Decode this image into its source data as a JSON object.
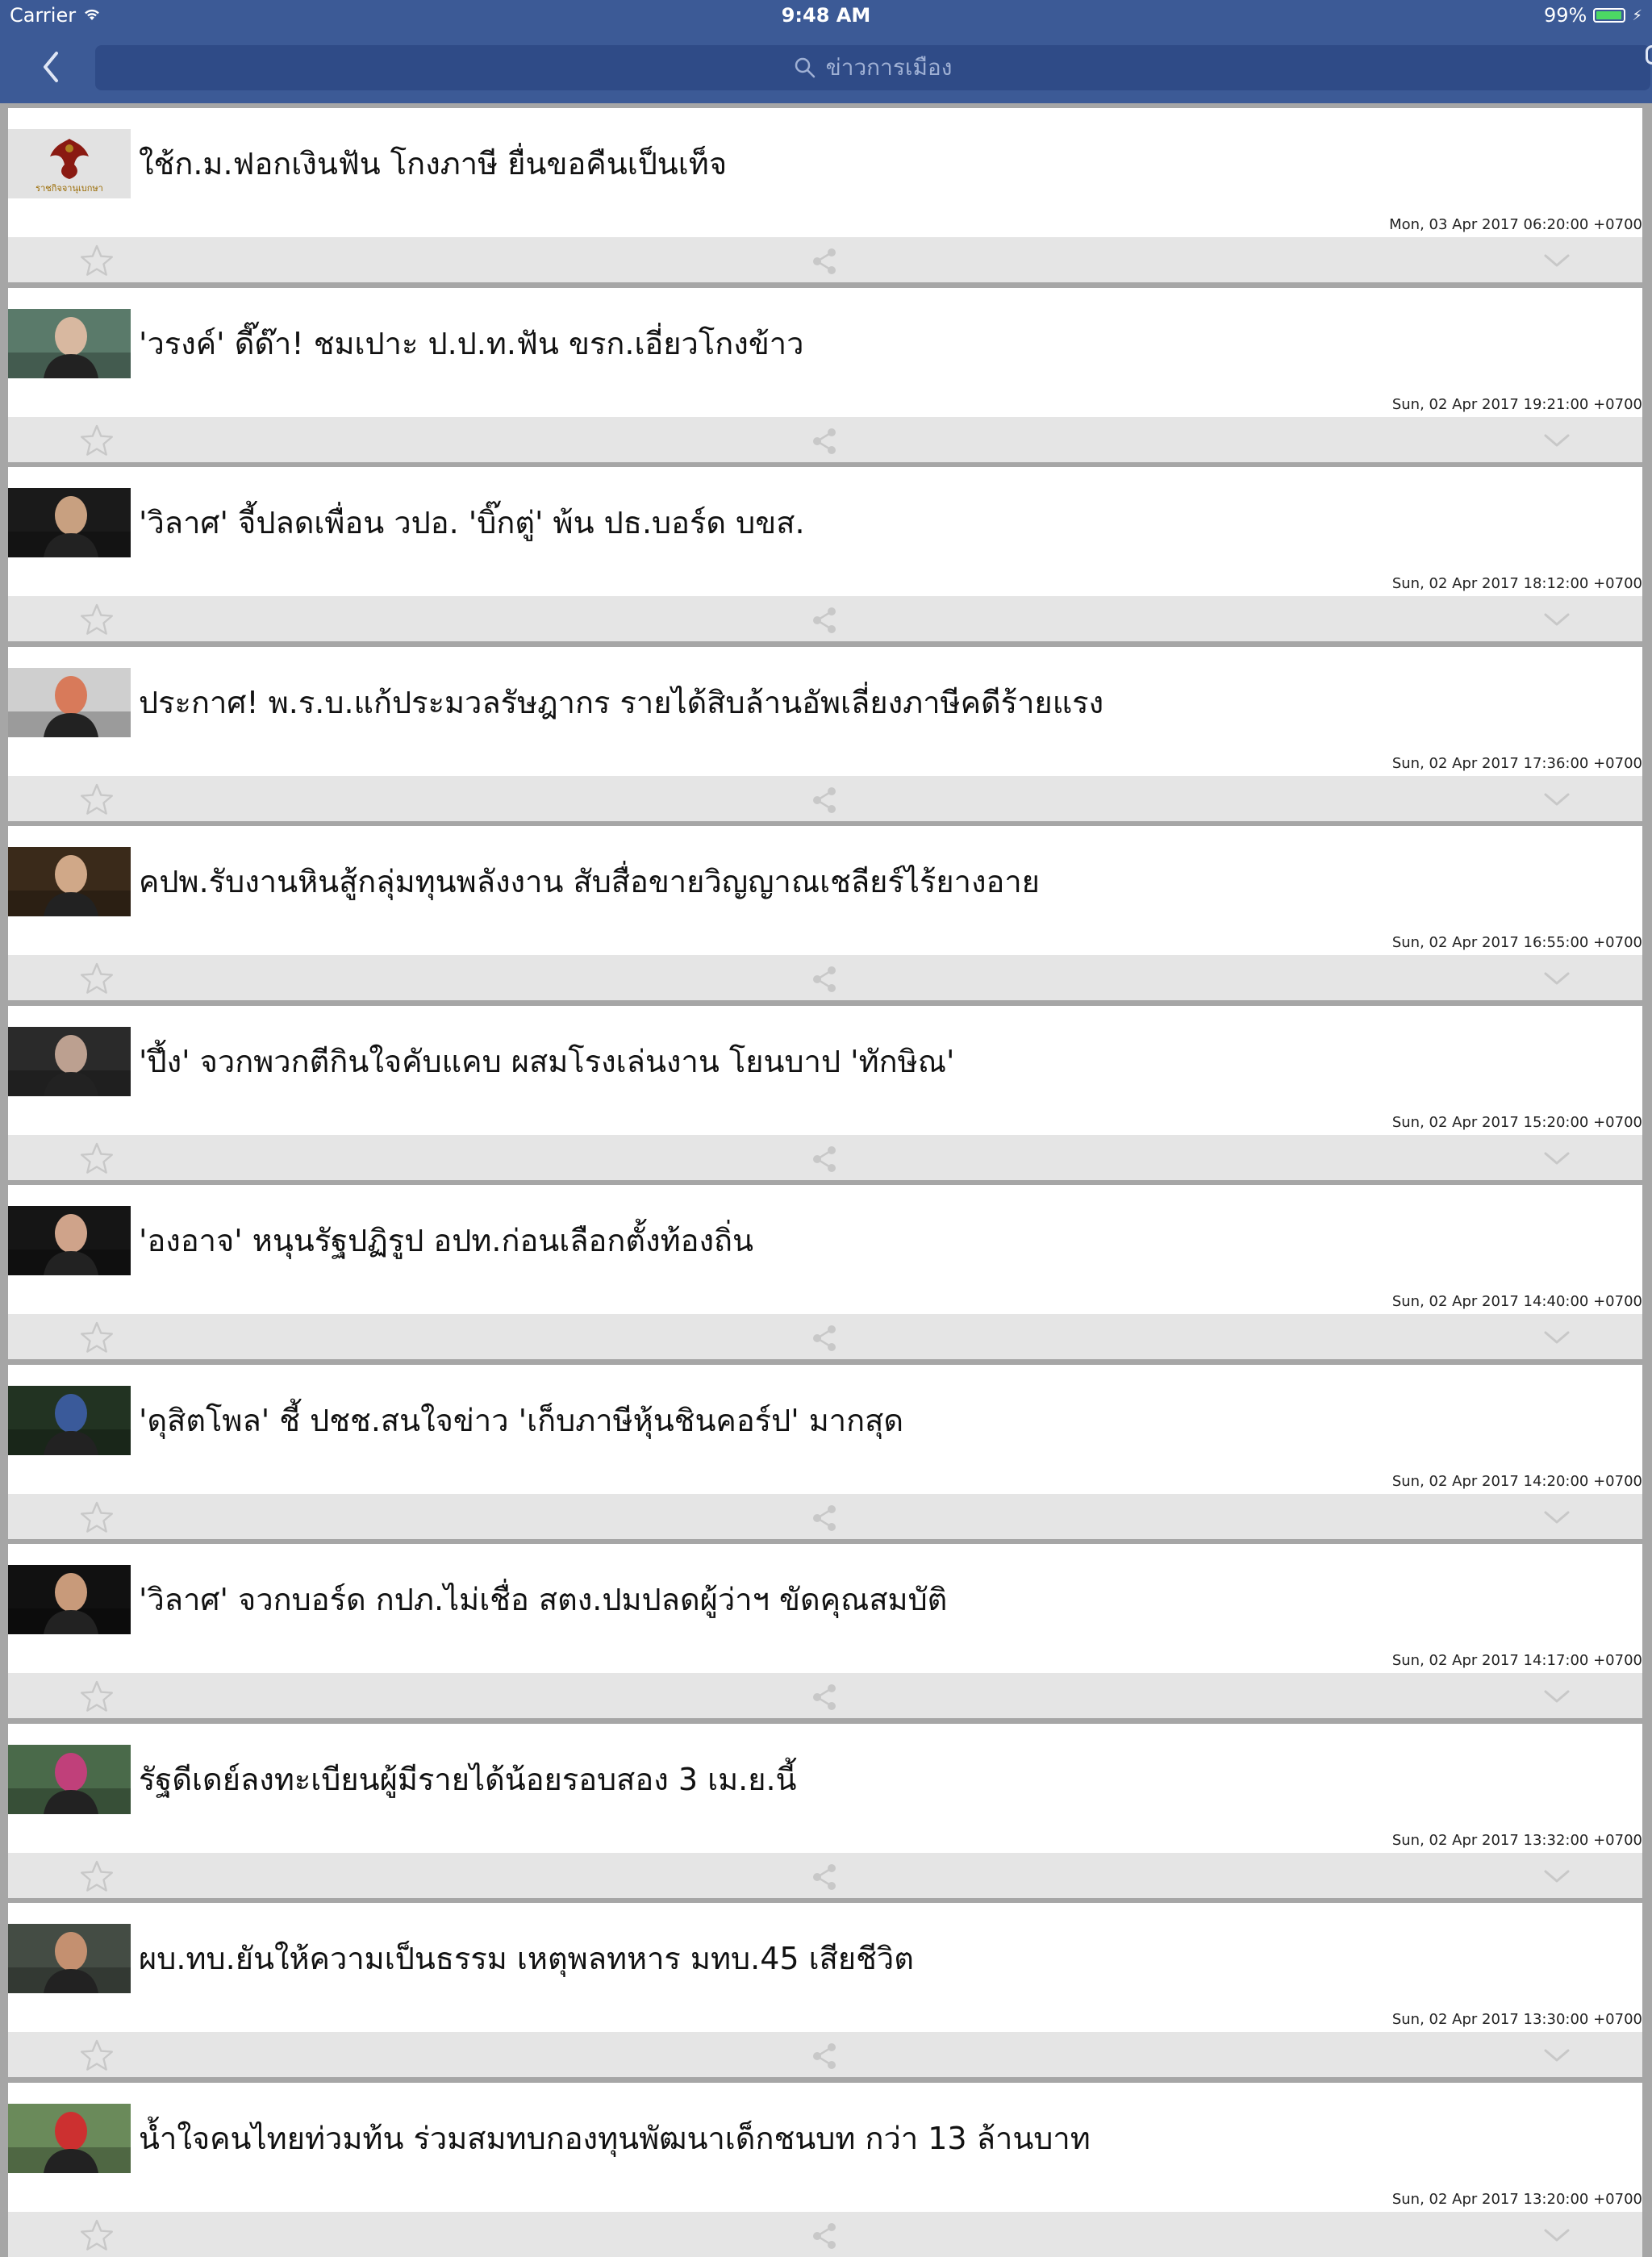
{
  "status_bar": {
    "carrier": "Carrier",
    "time": "9:48 AM",
    "battery": "99%"
  },
  "nav": {
    "search_placeholder": "ข่าวการเมือง"
  },
  "colors": {
    "bar_blue": "#3c5a96",
    "search_bg": "#2f4b87",
    "action_bar": "#e5e5e5",
    "separator": "#a6a6a6"
  },
  "icons": {
    "back": "chevron-left-icon",
    "search": "search-icon",
    "menu": "hamburger-menu-icon",
    "favorite": "star-icon",
    "share": "share-icon",
    "expand": "chevron-down-icon"
  },
  "articles": [
    {
      "headline": "ใช้ก.ม.ฟอกเงินฟัน โกงภาษี ยื่นขอคืนเป็นเท็จ",
      "timestamp": "Mon, 03 Apr 2017 06:20:00 +0700",
      "thumb_caption": "ราชกิจจานุเบกษา"
    },
    {
      "headline": "'วรงค์' ดี๊ด๊า! ชมเปาะ ป.ป.ท.ฟัน ขรก.เอี่ยวโกงข้าว",
      "timestamp": "Sun, 02 Apr 2017 19:21:00 +0700"
    },
    {
      "headline": "'วิลาศ' จี้ปลดเพื่อน วปอ. 'บิ๊กตู่' พ้น ปธ.บอร์ด บขส.",
      "timestamp": "Sun, 02 Apr 2017 18:12:00 +0700"
    },
    {
      "headline": "ประกาศ! พ.ร.บ.แก้ประมวลรัษฎากร รายได้สิบล้านอัพเลี่ยงภาษีคดีร้ายแรง",
      "timestamp": "Sun, 02 Apr 2017 17:36:00 +0700"
    },
    {
      "headline": "คปพ.รับงานหินสู้กลุ่มทุนพลังงาน สับสื่อขายวิญญาณเชลียร์ไร้ยางอาย",
      "timestamp": "Sun, 02 Apr 2017 16:55:00 +0700"
    },
    {
      "headline": "'ปึ้ง' จวกพวกตีกินใจคับแคบ ผสมโรงเล่นงาน โยนบาป 'ทักษิณ'",
      "timestamp": "Sun, 02 Apr 2017 15:20:00 +0700"
    },
    {
      "headline": "'องอาจ' หนุนรัฐปฏิรูป อปท.ก่อนเลือกตั้งท้องถิ่น",
      "timestamp": "Sun, 02 Apr 2017 14:40:00 +0700"
    },
    {
      "headline": "'ดุสิตโพล' ชี้ ปชช.สนใจข่าว 'เก็บภาษีหุ้นชินคอร์ป' มากสุด",
      "timestamp": "Sun, 02 Apr 2017 14:20:00 +0700"
    },
    {
      "headline": "'วิลาศ' จวกบอร์ด กปภ.ไม่เชื่อ สตง.ปมปลดผู้ว่าฯ ขัดคุณสมบัติ",
      "timestamp": "Sun, 02 Apr 2017 14:17:00 +0700"
    },
    {
      "headline": "รัฐดีเดย์ลงทะเบียนผู้มีรายได้น้อยรอบสอง 3 เม.ย.นี้",
      "timestamp": "Sun, 02 Apr 2017 13:32:00 +0700"
    },
    {
      "headline": "ผบ.ทบ.ยันให้ความเป็นธรรม เหตุพลทหาร มทบ.45 เสียชีวิต",
      "timestamp": "Sun, 02 Apr 2017 13:30:00 +0700"
    },
    {
      "headline": "น้ำใจคนไทยท่วมท้น ร่วมสมทบกองทุนพัฒนาเด็กชนบท กว่า 13 ล้านบาท",
      "timestamp": "Sun, 02 Apr 2017 13:20:00 +0700"
    }
  ]
}
